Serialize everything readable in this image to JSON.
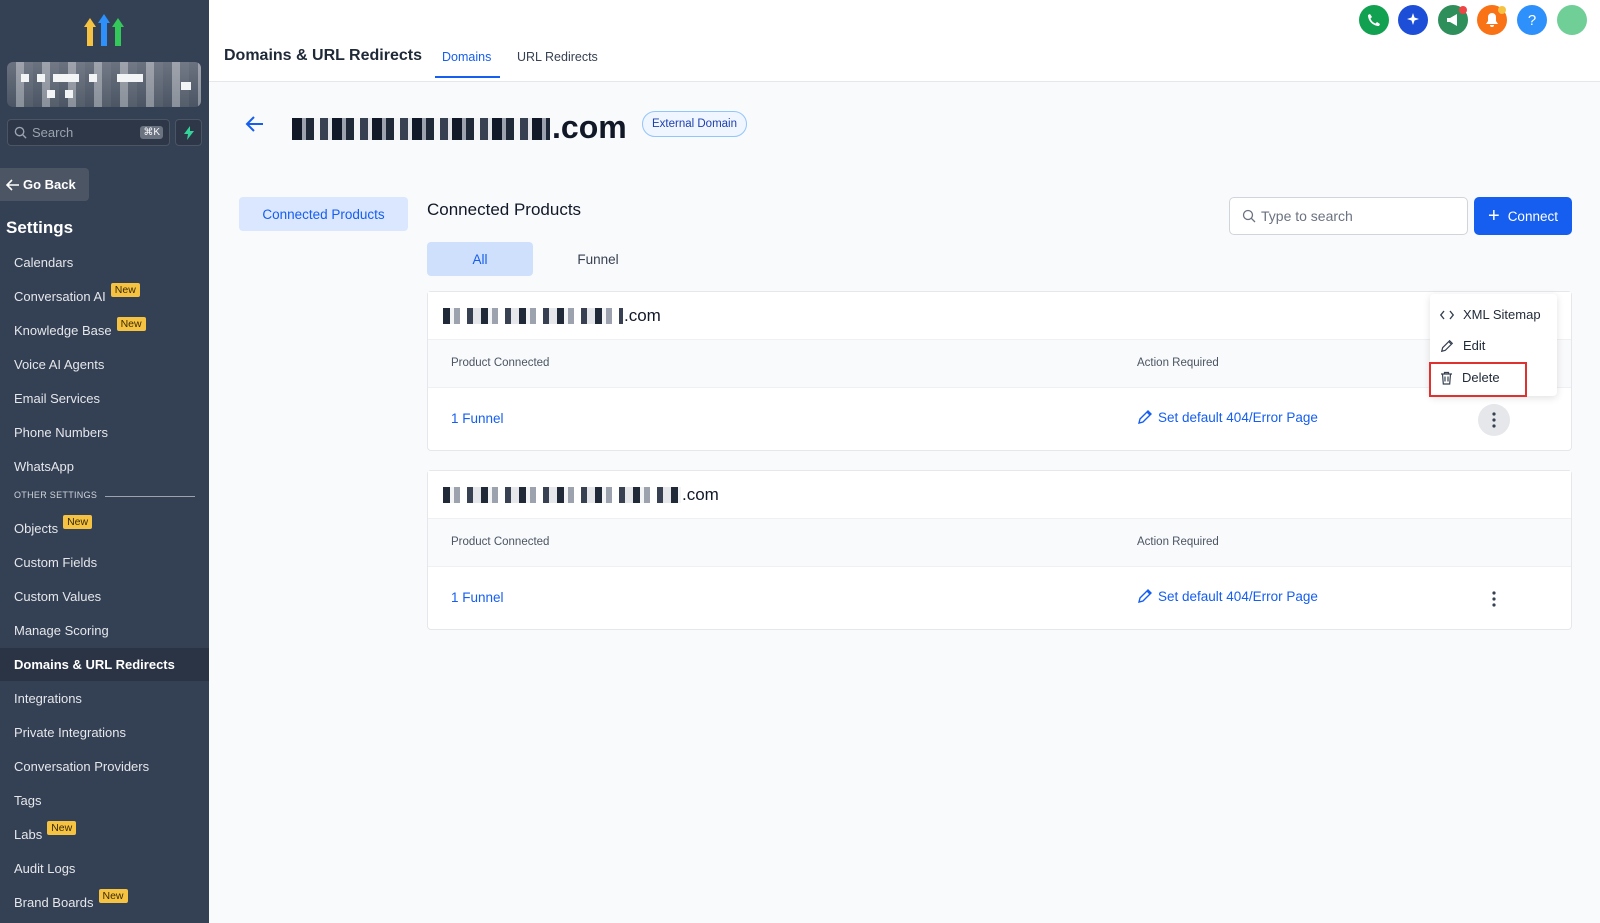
{
  "sidebar": {
    "search_placeholder": "Search",
    "search_shortcut": "⌘K",
    "go_back": "Go Back",
    "settings_title": "Settings",
    "new_badge": "New",
    "other_settings_label": "OTHER SETTINGS",
    "items": [
      {
        "label": "Calendars",
        "new": false
      },
      {
        "label": "Conversation AI",
        "new": true
      },
      {
        "label": "Knowledge Base",
        "new": true
      },
      {
        "label": "Voice AI Agents",
        "new": false
      },
      {
        "label": "Email Services",
        "new": false
      },
      {
        "label": "Phone Numbers",
        "new": false
      },
      {
        "label": "WhatsApp",
        "new": false
      }
    ],
    "other_items": [
      {
        "label": "Objects",
        "new": true
      },
      {
        "label": "Custom Fields",
        "new": false
      },
      {
        "label": "Custom Values",
        "new": false
      },
      {
        "label": "Manage Scoring",
        "new": false
      },
      {
        "label": "Domains & URL Redirects",
        "new": false,
        "active": true
      },
      {
        "label": "Integrations",
        "new": false
      },
      {
        "label": "Private Integrations",
        "new": false
      },
      {
        "label": "Conversation Providers",
        "new": false
      },
      {
        "label": "Tags",
        "new": false
      },
      {
        "label": "Labs",
        "new": true
      },
      {
        "label": "Audit Logs",
        "new": false
      },
      {
        "label": "Brand Boards",
        "new": true
      }
    ]
  },
  "header": {
    "title": "Domains & URL Redirects",
    "tabs": [
      {
        "label": "Domains",
        "active": true
      },
      {
        "label": "URL Redirects",
        "active": false
      }
    ],
    "icons": [
      {
        "name": "phone-icon",
        "color": "#12a150"
      },
      {
        "name": "sparkle-icon",
        "color": "#1d4ed8"
      },
      {
        "name": "megaphone-icon",
        "color": "#2f8f5b"
      },
      {
        "name": "bell-icon",
        "color": "#f97316"
      },
      {
        "name": "help-icon",
        "color": "#2e90fa"
      },
      {
        "name": "avatar",
        "color": "#6fcf97"
      }
    ]
  },
  "domain": {
    "suffix": ".com",
    "badge": "External Domain"
  },
  "left_nav": {
    "connected_products": "Connected Products"
  },
  "main": {
    "title": "Connected Products",
    "search_placeholder": "Type to search",
    "connect_label": "Connect",
    "filters": [
      "All",
      "Funnel"
    ],
    "columns": {
      "product": "Product Connected",
      "action": "Action Required"
    },
    "cards": [
      {
        "domain_suffix": ".com",
        "product": "1 Funnel",
        "action": "Set default 404/Error Page"
      },
      {
        "domain_suffix": ".com",
        "product": "1 Funnel",
        "action": "Set default 404/Error Page"
      }
    ]
  },
  "menu": {
    "items": [
      "XML Sitemap",
      "Edit",
      "Delete"
    ]
  },
  "colors": {
    "sidebar_bg": "#344054",
    "accent": "#155eef",
    "highlight": "#e03131",
    "badge_new": "#f5c242"
  }
}
